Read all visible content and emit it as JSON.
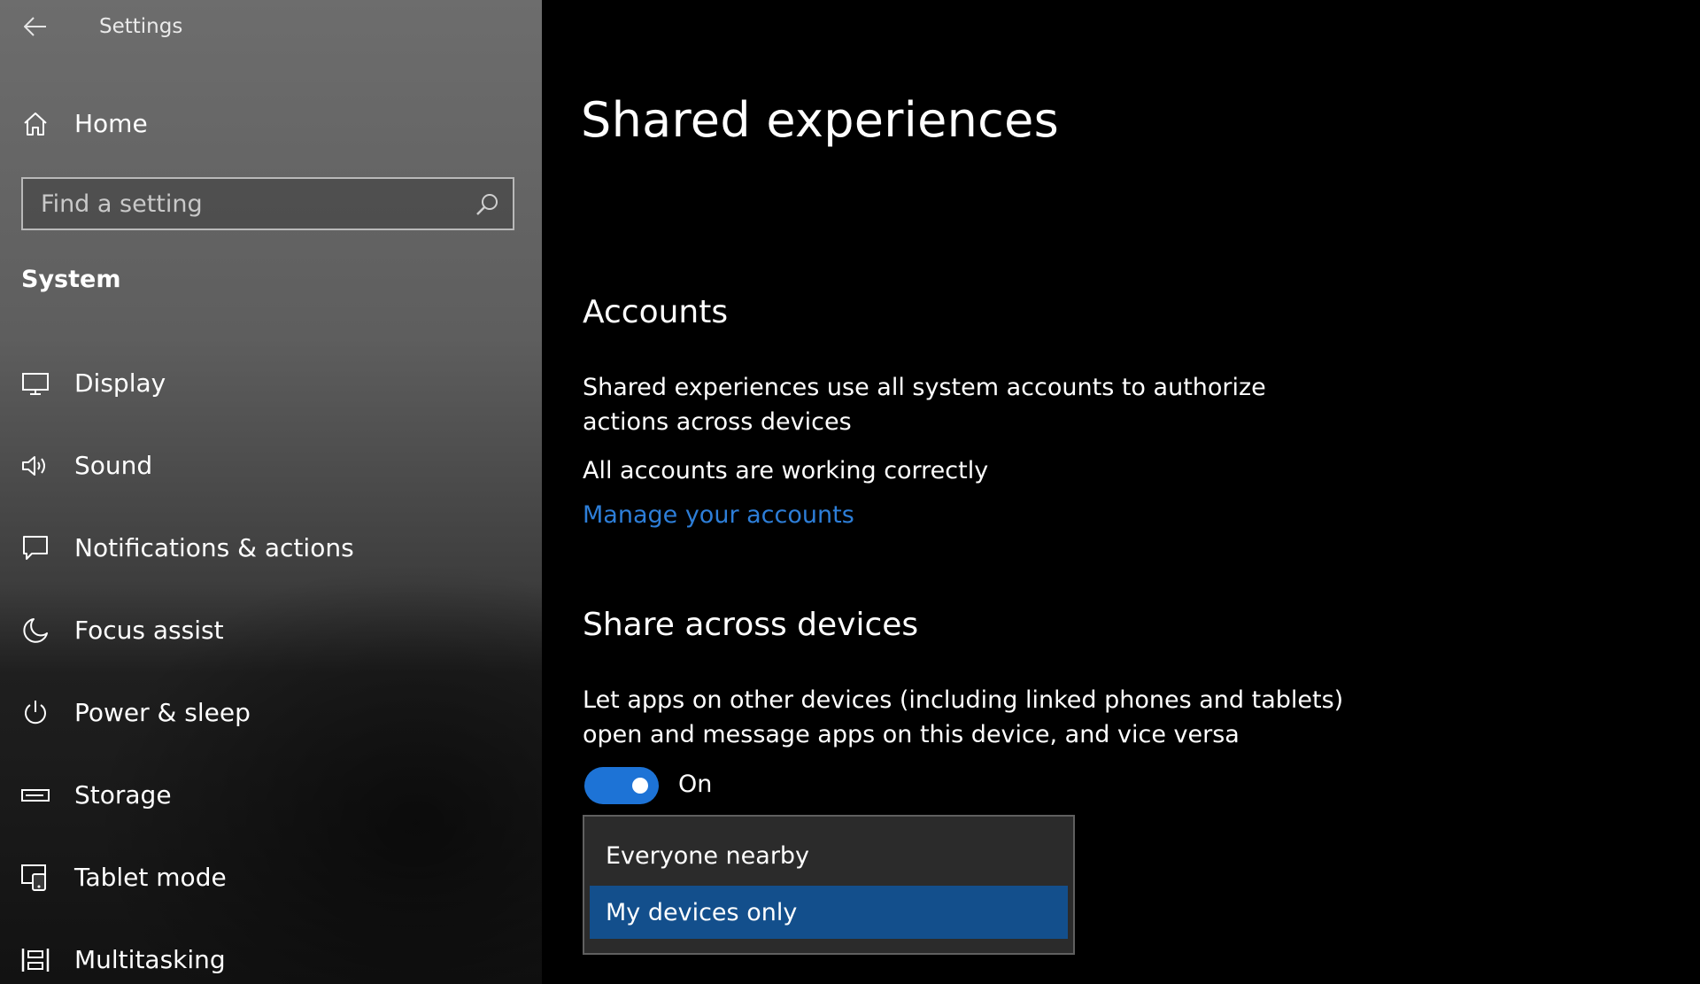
{
  "window": {
    "title": "Settings"
  },
  "sidebar": {
    "home_label": "Home",
    "search": {
      "placeholder": "Find a setting",
      "value": ""
    },
    "section_heading": "System",
    "items": [
      {
        "label": "Display",
        "icon": "display-icon"
      },
      {
        "label": "Sound",
        "icon": "speaker-icon"
      },
      {
        "label": "Notifications & actions",
        "icon": "notification-icon"
      },
      {
        "label": "Focus assist",
        "icon": "moon-icon"
      },
      {
        "label": "Power & sleep",
        "icon": "power-icon"
      },
      {
        "label": "Storage",
        "icon": "storage-icon"
      },
      {
        "label": "Tablet mode",
        "icon": "tablet-mode-icon"
      },
      {
        "label": "Multitasking",
        "icon": "multitasking-icon"
      }
    ]
  },
  "main": {
    "title": "Shared experiences",
    "accounts": {
      "heading": "Accounts",
      "description": "Shared experiences use all system accounts to authorize actions across devices",
      "status": "All accounts are working correctly",
      "link": "Manage your accounts"
    },
    "share": {
      "heading": "Share across devices",
      "description": "Let apps on other devices (including linked phones and tablets) open and message apps on this device, and vice versa",
      "toggle_state": "On",
      "dropdown_options": [
        {
          "label": "Everyone nearby",
          "selected": false
        },
        {
          "label": "My devices only",
          "selected": true
        }
      ]
    }
  },
  "colors": {
    "accent": "#1d73d6",
    "link": "#2d7ed8",
    "selected_option": "#134f8c"
  }
}
